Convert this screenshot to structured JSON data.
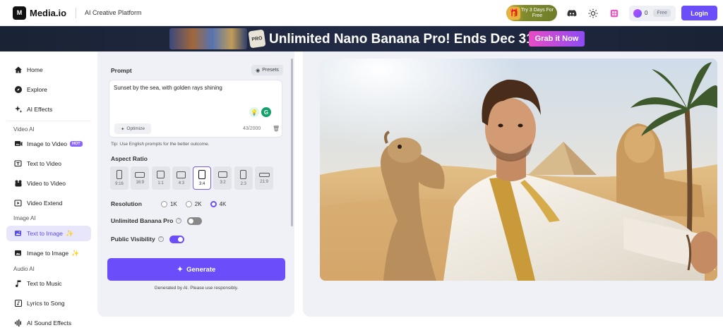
{
  "header": {
    "logo_mark": "M",
    "logo_text": "Media.io",
    "platform_label": "AI Creative Platform",
    "trial_text": "Try 3 Days For Free",
    "credits": "0",
    "free_badge": "Free",
    "login_label": "Login",
    "icons": [
      "gift-icon",
      "discord-icon",
      "theme-toggle-icon",
      "app-grid-icon",
      "credits-icon"
    ]
  },
  "banner": {
    "badge": "PRO",
    "headline": "Unlimited Nano Banana Pro! Ends Dec 31.",
    "cta_label": "Grab it Now"
  },
  "sidebar": {
    "items": [
      {
        "label": "Home",
        "icon": "home-icon"
      },
      {
        "label": "Explore",
        "icon": "compass-icon"
      },
      {
        "label": "AI Effects",
        "icon": "sparkle-icon"
      }
    ],
    "sections": [
      {
        "title": "Video AI",
        "items": [
          {
            "label": "Image to Video",
            "icon": "image-video-icon",
            "badge": "HOT"
          },
          {
            "label": "Text to Video",
            "icon": "text-video-icon"
          },
          {
            "label": "Video to Video",
            "icon": "video-video-icon"
          },
          {
            "label": "Video Extend",
            "icon": "video-extend-icon"
          }
        ]
      },
      {
        "title": "Image AI",
        "items": [
          {
            "label": "Text to Image",
            "icon": "text-image-icon",
            "active": true
          },
          {
            "label": "Image to Image",
            "icon": "image-image-icon"
          }
        ]
      },
      {
        "title": "Audio AI",
        "items": [
          {
            "label": "Text to Music",
            "icon": "music-icon"
          },
          {
            "label": "Lyrics to Song",
            "icon": "lyrics-icon"
          },
          {
            "label": "AI Sound Effects",
            "icon": "sound-icon"
          }
        ]
      }
    ]
  },
  "panel": {
    "prompt_label": "Prompt",
    "presets_label": "Presets",
    "prompt_value": "Sunset by the sea, with golden rays shining",
    "optimize_label": "Optimize",
    "char_count": "43/2000",
    "tip": "Tip: Use English prompts for the better outcome.",
    "aspect_label": "Aspect Ratio",
    "aspect_ratios": [
      "9:16",
      "16:9",
      "1:1",
      "4:3",
      "3:4",
      "3:2",
      "2:3",
      "21:9"
    ],
    "aspect_selected": "3:4",
    "resolution_label": "Resolution",
    "resolutions": [
      "1K",
      "2K",
      "4K"
    ],
    "resolution_selected": "4K",
    "unlimited_label": "Unlimited Banana Pro",
    "unlimited_on": false,
    "visibility_label": "Public Visibility",
    "visibility_on": true,
    "generate_label": "Generate",
    "disclaimer": "Generated by AI. Please use responsibly."
  },
  "colors": {
    "accent": "#6b4efa",
    "banner_bg": "#1b2338",
    "panel_bg": "#eff1f6"
  }
}
